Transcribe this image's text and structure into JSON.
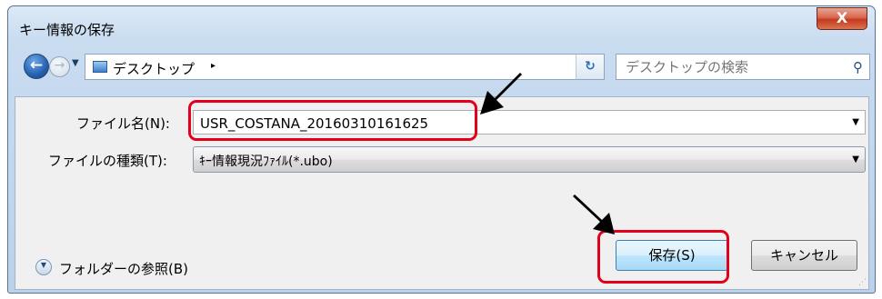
{
  "window": {
    "title": "キー情報の保存",
    "close_label": "X"
  },
  "navbar": {
    "back_glyph": "←",
    "forward_glyph": "→",
    "address": "デスクトップ",
    "address_arrow": "▸",
    "search_placeholder": "デスクトップの検索"
  },
  "form": {
    "filename_label": "ファイル名(N):",
    "filename_value": "USR_COSTANA_20160310161625",
    "filetype_label": "ファイルの種類(T):",
    "filetype_value": "ｷｰ情報現況ﾌｧｲﾙ(*.ubo)"
  },
  "footer": {
    "browse_label": "フォルダーの参照(B)",
    "save_label": "保存(S)",
    "cancel_label": "キャンセル"
  },
  "colors": {
    "highlight": "#e2001a",
    "arrow": "#000000"
  }
}
